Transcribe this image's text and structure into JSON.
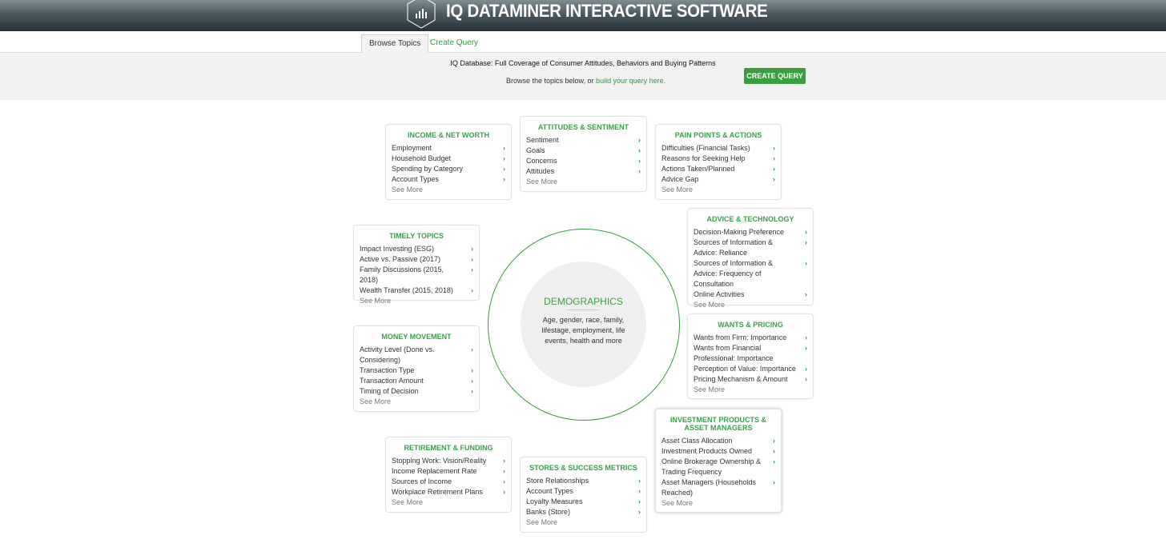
{
  "header": {
    "title": "IQ DATAMINER INTERACTIVE SOFTWARE",
    "logo_icon": "bar-chart-hexagon-icon"
  },
  "tabs": [
    {
      "label": "Browse Topics",
      "active": true
    },
    {
      "label": "Create Query",
      "active": false
    }
  ],
  "info": {
    "title": "IQ Database: Full Coverage of Consumer Attitudes, Behaviors and Buying Patterns",
    "browse_prefix": "Browse the topics below, or ",
    "browse_link": "build your query here.",
    "create_button": "CREATE QUERY"
  },
  "center": {
    "title": "DEMOGRAPHICS",
    "description": "Age, gender, race, family, lifestage, employment, life events, health and more"
  },
  "accent_color": "#3a9e3f",
  "see_more": "See More",
  "cards": {
    "income": {
      "title": "INCOME & NET WORTH",
      "items": [
        "Employment",
        "Household Budget",
        "Spending by Category",
        "Account Types"
      ]
    },
    "attitudes": {
      "title": "ATTITUDES & SENTIMENT",
      "items": [
        "Sentiment",
        "Goals",
        "Concerns",
        "Attitudes"
      ]
    },
    "pain": {
      "title": "PAIN POINTS & ACTIONS",
      "items": [
        "Difficulties (Financial Tasks)",
        "Reasons for Seeking Help",
        "Actions Taken/Planned",
        "Advice Gap"
      ]
    },
    "timely": {
      "title": "TIMELY TOPICS",
      "items": [
        "Impact Investing (ESG)",
        "Active vs. Passive (2017)",
        "Family Discussions (2015, 2018)",
        "Wealth Transfer (2015, 2018)"
      ]
    },
    "advice": {
      "title": "ADVICE & TECHNOLOGY",
      "items": [
        "Decision-Making Preference",
        "Sources of Information & Advice: Reliance",
        "Sources of Information & Advice: Frequency of Consultation",
        "Online Activities"
      ]
    },
    "money": {
      "title": "MONEY MOVEMENT",
      "items": [
        "Activity Level (Done vs. Considering)",
        "Transaction Type",
        "Transaction Amount",
        "Timing of Decision"
      ]
    },
    "wants": {
      "title": "WANTS & PRICING",
      "items": [
        "Wants from Firm: Importance",
        "Wants from Financial Professional: Importance",
        "Perception of Value: Importance",
        "Pricing Mechanism & Amount"
      ]
    },
    "investment": {
      "title": "INVESTMENT PRODUCTS & ASSET MANAGERS",
      "items": [
        "Asset Class Allocation",
        "Investment Products Owned",
        "Online Brokerage Ownership & Trading Frequency",
        "Asset Managers (Households Reached)"
      ]
    },
    "retirement": {
      "title": "RETIREMENT & FUNDING",
      "items": [
        "Stopping Work: Vision/Reality",
        "Income Replacement Rate",
        "Sources of Income",
        "Workplace Retirement Plans"
      ]
    },
    "stores": {
      "title": "STORES & SUCCESS METRICS",
      "items": [
        "Store Relationships",
        "Account Types",
        "Loyalty Measures",
        "Banks (Store)"
      ]
    }
  }
}
